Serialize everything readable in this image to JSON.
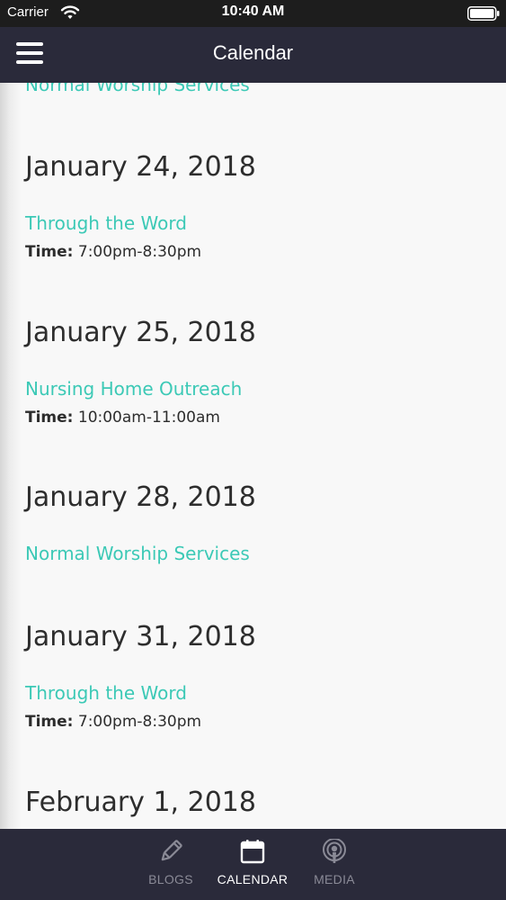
{
  "status_bar": {
    "carrier": "Carrier",
    "time": "10:40 AM"
  },
  "nav": {
    "title": "Calendar"
  },
  "calendar": {
    "partial_event": "Normal Worship Services",
    "days": [
      {
        "date": "January 24, 2018",
        "event_title": "Through the Word",
        "time_label": "Time:",
        "time": "7:00pm-8:30pm"
      },
      {
        "date": "January 25, 2018",
        "event_title": "Nursing Home Outreach",
        "time_label": "Time:",
        "time": "10:00am-11:00am"
      },
      {
        "date": "January 28, 2018",
        "event_title": "Normal Worship Services"
      },
      {
        "date": "January 31, 2018",
        "event_title": "Through the Word",
        "time_label": "Time:",
        "time": "7:00pm-8:30pm"
      },
      {
        "date": "February 1, 2018"
      }
    ]
  },
  "tabs": [
    {
      "label": "BLOGS",
      "icon": "pencil-icon",
      "active": false
    },
    {
      "label": "CALENDAR",
      "icon": "calendar-icon",
      "active": true
    },
    {
      "label": "MEDIA",
      "icon": "podcast-icon",
      "active": false
    }
  ],
  "colors": {
    "accent": "#3cc9b6",
    "bar_background": "#2a2a3a",
    "status_bar": "#1d1d1d",
    "text": "#2d2d2d",
    "tab_inactive": "#8a8a96"
  }
}
